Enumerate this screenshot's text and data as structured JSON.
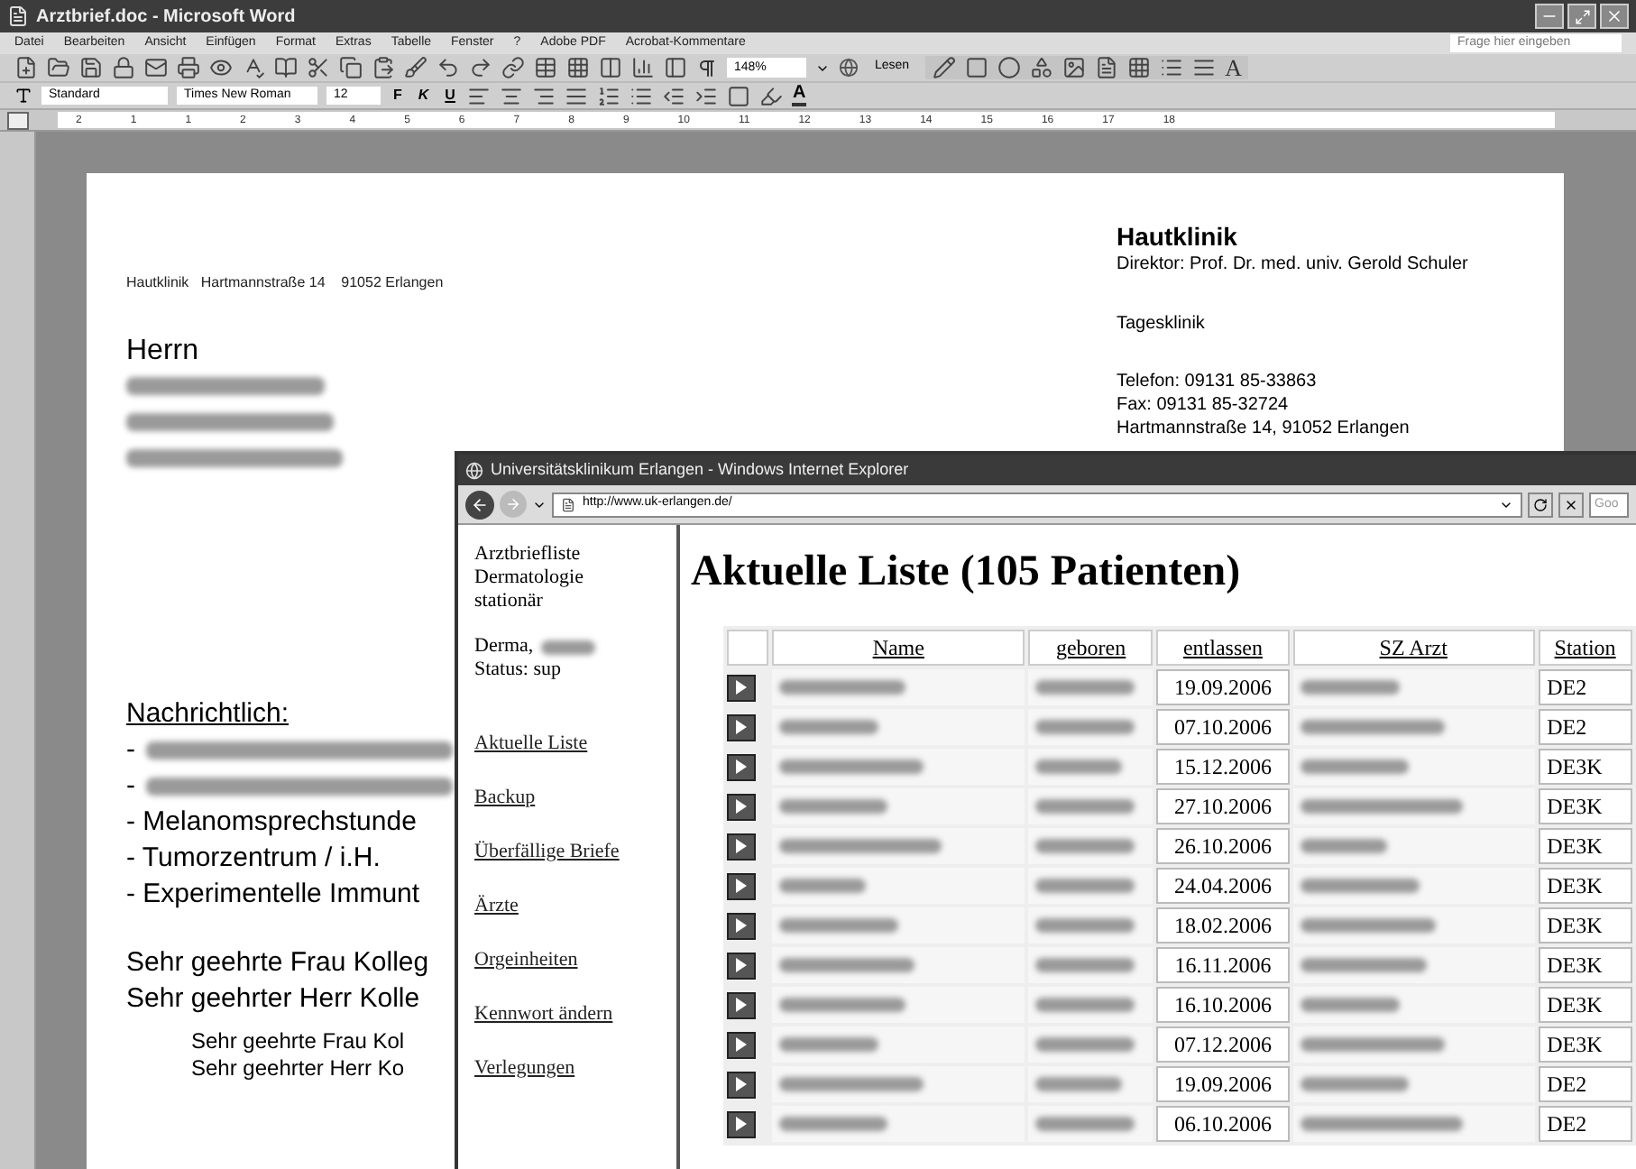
{
  "word": {
    "title": "Arztbrief.doc - Microsoft Word",
    "menu": [
      "Datei",
      "Bearbeiten",
      "Ansicht",
      "Einfügen",
      "Format",
      "Extras",
      "Tabelle",
      "Fenster",
      "?",
      "Adobe PDF",
      "Acrobat-Kommentare"
    ],
    "help_field": {
      "placeholder": "Frage hier eingeben"
    },
    "zoom": "148%",
    "read_button": "Lesen",
    "drawing_text_button": "A",
    "format": {
      "style": "Standard",
      "font": "Times New Roman",
      "size": "12",
      "bold": "F",
      "italic": "K",
      "underline": "U",
      "font_color": "A"
    },
    "ruler": [
      "2",
      "1",
      "1",
      "2",
      "3",
      "4",
      "5",
      "6",
      "7",
      "8",
      "9",
      "10",
      "11",
      "12",
      "13",
      "14",
      "15",
      "16",
      "17",
      "18"
    ],
    "letter": {
      "sender_line": "Hautklinik   Hartmannstraße 14    91052 Erlangen",
      "salutation": "Herrn",
      "address_lines": [
        {
          "kind": "blurred"
        },
        {
          "kind": "blurred"
        },
        {
          "kind": "blurred"
        }
      ],
      "copies_heading": "Nachrichtlich:",
      "copies": [
        {
          "kind": "blurred",
          "text": "-"
        },
        {
          "kind": "blurred",
          "text": "-"
        },
        {
          "kind": "text",
          "text": "- Melanomsprechstunde"
        },
        {
          "kind": "text",
          "text": "- Tumorzentrum / i.H."
        },
        {
          "kind": "text",
          "text": "- Experimentelle Immunt"
        }
      ],
      "greetings": [
        "Sehr geehrte Frau Kolleg",
        "Sehr geehrter Herr Kolle"
      ],
      "greetings_small": [
        "Sehr geehrte Frau Kol",
        "Sehr geehrter Herr Ko"
      ],
      "clinic": "Hautklinik",
      "director": "Direktor: Prof. Dr. med. univ. Gerold Schuler",
      "unit": "Tagesklinik",
      "contact": [
        "Telefon: 09131 85-33863",
        "Fax: 09131 85-32724",
        "Hartmannstraße 14, 91052 Erlangen"
      ]
    }
  },
  "browser": {
    "title": "Universitätsklinikum Erlangen - Windows Internet Explorer",
    "url": "http://www.uk-erlangen.de/",
    "search": {
      "placeholder": "Goo"
    },
    "sidebar": {
      "heading": "Arztbriefliste Dermatologie stationär",
      "user": "Derma,",
      "status": "Status: sup",
      "links": [
        "Aktuelle Liste",
        "Backup",
        "Überfällige Briefe",
        "Ärzte",
        "Orgeinheiten",
        "Kennwort ändern",
        "Verlegungen"
      ]
    },
    "page_title": "Aktuelle Liste (105 Patienten)",
    "table": {
      "columns": [
        {
          "label": "Name",
          "kind": "blurred"
        },
        {
          "label": "geboren",
          "kind": "blurred"
        },
        {
          "label": "entlassen",
          "kind": "text"
        },
        {
          "label": "SZ Arzt",
          "kind": "blurred"
        },
        {
          "label": "Station",
          "kind": "text"
        }
      ],
      "rows": [
        {
          "values": [
            "19.09.2006",
            "DE2"
          ]
        },
        {
          "values": [
            "07.10.2006",
            "DE2"
          ]
        },
        {
          "values": [
            "15.12.2006",
            "DE3K"
          ]
        },
        {
          "values": [
            "27.10.2006",
            "DE3K"
          ]
        },
        {
          "values": [
            "26.10.2006",
            "DE3K"
          ]
        },
        {
          "values": [
            "24.04.2006",
            "DE3K"
          ]
        },
        {
          "values": [
            "18.02.2006",
            "DE3K"
          ]
        },
        {
          "values": [
            "16.11.2006",
            "DE3K"
          ]
        },
        {
          "values": [
            "16.10.2006",
            "DE3K"
          ]
        },
        {
          "values": [
            "07.12.2006",
            "DE3K"
          ]
        },
        {
          "values": [
            "19.09.2006",
            "DE2"
          ]
        },
        {
          "values": [
            "06.10.2006",
            "DE2"
          ]
        }
      ]
    }
  }
}
